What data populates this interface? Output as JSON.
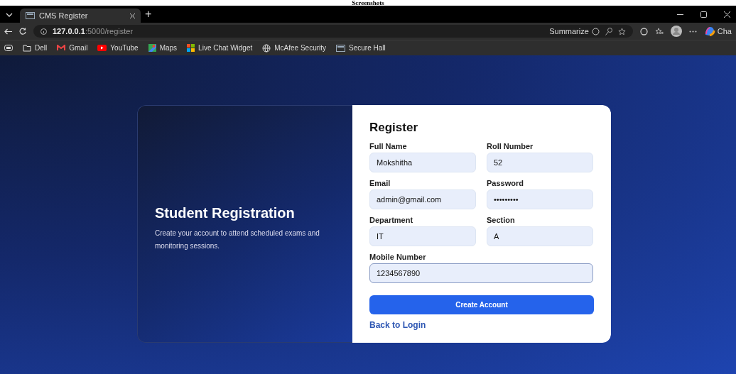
{
  "caption": "Screenshots",
  "browser": {
    "tabs": [
      {
        "title": "CMS Register",
        "selected": true
      }
    ],
    "address": {
      "host": "127.0.0.1",
      "path": ":5000/register"
    },
    "new_tab": "+",
    "toolbar": {
      "summarize": "Summarize",
      "copilot": "Cha"
    },
    "bookmarks": [
      {
        "label": "Dell",
        "kind": "folder"
      },
      {
        "label": "Gmail",
        "kind": "gmail"
      },
      {
        "label": "YouTube",
        "kind": "youtube"
      },
      {
        "label": "Maps",
        "kind": "maps"
      },
      {
        "label": "Live Chat Widget",
        "kind": "tiles"
      },
      {
        "label": "McAfee Security",
        "kind": "globe"
      },
      {
        "label": "Secure Hall",
        "kind": "page"
      }
    ]
  },
  "intro": {
    "title": "Student Registration",
    "text": "Create your account to attend scheduled exams and monitoring sessions."
  },
  "form": {
    "title": "Register",
    "fields": [
      {
        "label": "Full Name",
        "value": "Mokshitha",
        "kind": "half",
        "focused": false
      },
      {
        "label": "Roll Number",
        "value": "52",
        "kind": "half",
        "focused": false
      },
      {
        "label": "Email",
        "value": "admin@gmail.com",
        "kind": "half",
        "focused": false
      },
      {
        "label": "Password",
        "value": "•••••••••",
        "kind": "half",
        "focused": false
      },
      {
        "label": "Department",
        "value": "IT",
        "kind": "half",
        "focused": false
      },
      {
        "label": "Section",
        "value": "A",
        "kind": "half",
        "focused": false
      },
      {
        "label": "Mobile Number",
        "value": "1234567890",
        "kind": "full",
        "focused": true
      }
    ],
    "submit": "Create Account",
    "back_link": "Back to Login"
  }
}
